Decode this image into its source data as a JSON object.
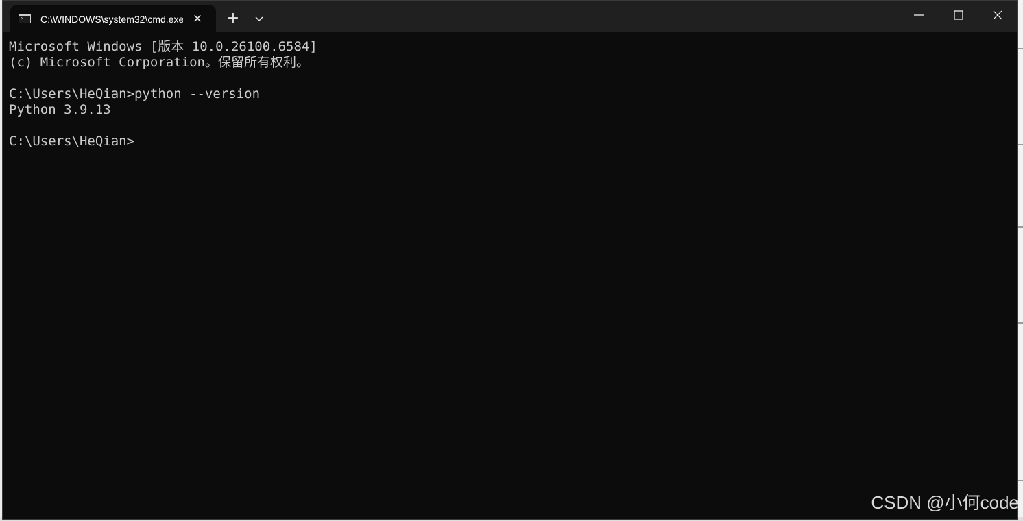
{
  "window": {
    "tab_title": "C:\\WINDOWS\\system32\\cmd.exe",
    "tab_close": "✕",
    "new_tab": "+"
  },
  "terminal": {
    "lines": [
      "Microsoft Windows [版本 10.0.26100.6584]",
      "(c) Microsoft Corporation。保留所有权利。",
      "",
      "C:\\Users\\HeQian>python --version",
      "Python 3.9.13",
      "",
      "C:\\Users\\HeQian>"
    ]
  },
  "watermark": "CSDN @小何code",
  "colors": {
    "terminal_bg": "#0c0c0c",
    "terminal_fg": "#cccccc",
    "titlebar_bg": "#202020"
  }
}
